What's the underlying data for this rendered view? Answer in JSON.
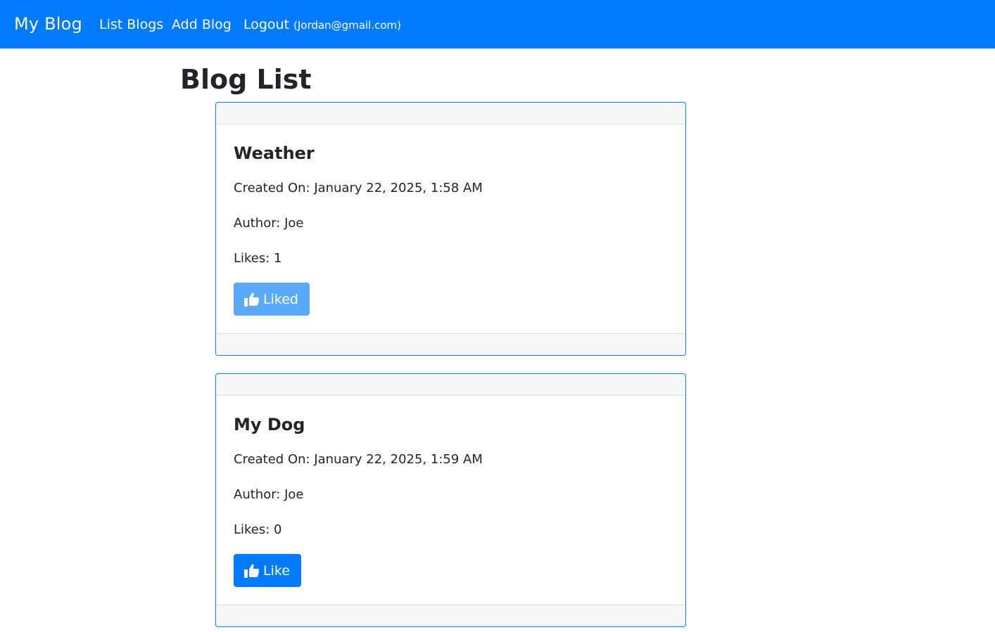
{
  "navbar": {
    "brand": "My Blog",
    "links": [
      {
        "label": "List Blogs"
      },
      {
        "label": "Add Blog"
      },
      {
        "label": "Logout",
        "email": "(Jordan@gmail.com)"
      }
    ],
    "color": "#007bff"
  },
  "page": {
    "title": "Blog List"
  },
  "blogs": [
    {
      "title": "Weather",
      "created": "Created On: January 22, 2025, 1:58 AM",
      "author": "Author: Joe",
      "likes": "Likes: 1",
      "button_label": "Liked",
      "button_icon": "thumbs-up-icon",
      "button_state": "liked",
      "button_color": "#5aa9fb"
    },
    {
      "title": "My Dog",
      "created": "Created On: January 22, 2025, 1:59 AM",
      "author": "Author: Joe",
      "likes": "Likes: 0",
      "button_label": "Like",
      "button_icon": "thumbs-up-icon",
      "button_state": "not-liked",
      "button_color": "#007bff"
    }
  ]
}
